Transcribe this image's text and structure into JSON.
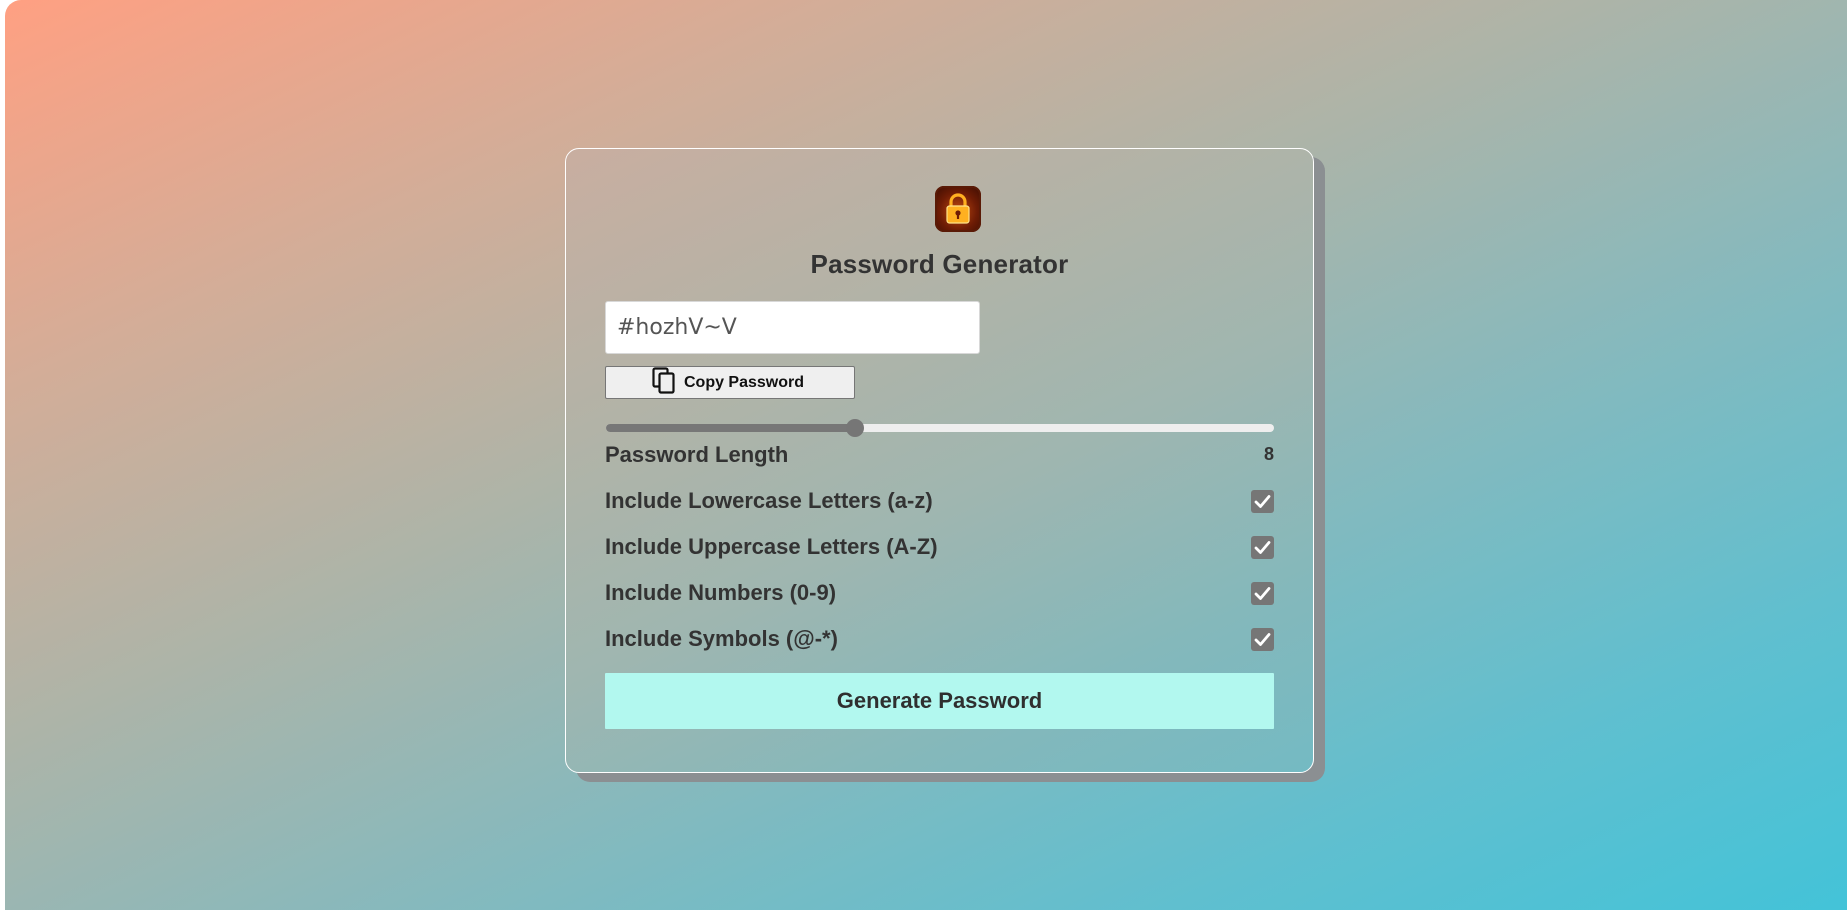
{
  "app": {
    "title": "Password Generator",
    "logo_icon": "padlock-icon"
  },
  "password": {
    "value": "#hozhV~V"
  },
  "copy_button": {
    "label": "Copy Password",
    "icon": "copy-icon"
  },
  "length": {
    "label": "Password Length",
    "value": "8",
    "slider_fraction": 0.373
  },
  "options": [
    {
      "label": "Include Lowercase Letters (a-z)",
      "checked": true
    },
    {
      "label": "Include Uppercase Letters (A-Z)",
      "checked": true
    },
    {
      "label": "Include Numbers (0-9)",
      "checked": true
    },
    {
      "label": "Include Symbols (@-*)",
      "checked": true
    }
  ],
  "generate_button": {
    "label": "Generate Password"
  },
  "colors": {
    "gradient_start": "#ffa082",
    "gradient_end": "#43c3d8",
    "generate_button_bg": "#b2f8ef",
    "checkbox_bg": "#767676"
  }
}
